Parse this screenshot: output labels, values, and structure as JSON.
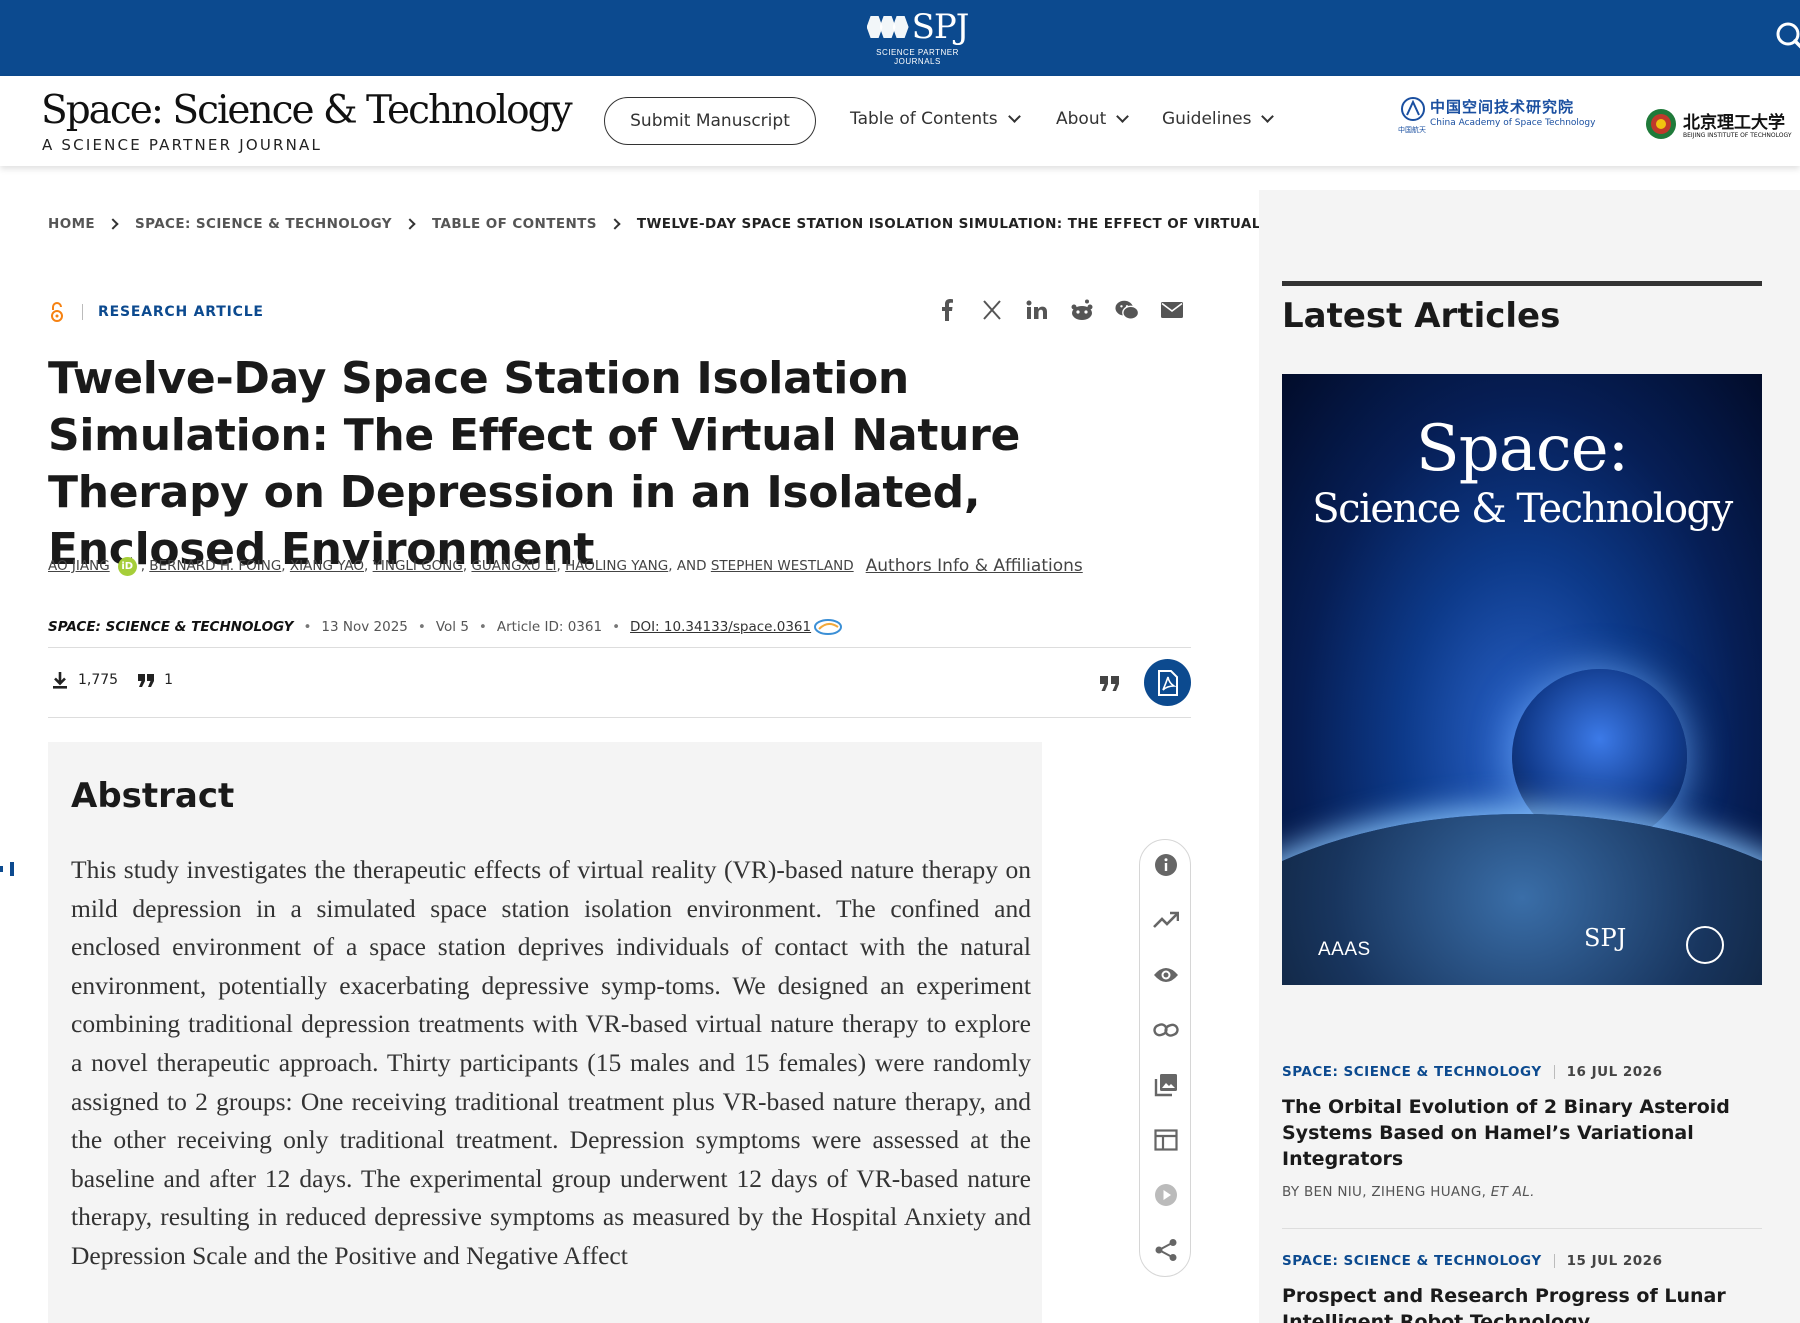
{
  "topbar": {
    "logo_text": "SPJ",
    "logo_sub": "SCIENCE PARTNER JOURNALS"
  },
  "header": {
    "journal_title": "Space: Science & Technology",
    "journal_subtitle": "A SCIENCE PARTNER JOURNAL",
    "submit_label": "Submit Manuscript",
    "nav": [
      "Table of Contents",
      "About",
      "Guidelines"
    ],
    "partner1_cn": "中国空间技术研究院",
    "partner1_en": "China Academy of Space Technology",
    "partner1_small": "中国航天",
    "partner2_cn": "北京理工大学",
    "partner2_en": "BEIJING INSTITUTE OF TECHNOLOGY"
  },
  "breadcrumb": [
    "HOME",
    "SPACE: SCIENCE & TECHNOLOGY",
    "TABLE OF CONTENTS",
    "TWELVE-DAY SPACE STATION ISOLATION SIMULATION: THE EFFECT OF VIRTUAL..."
  ],
  "article": {
    "type": "RESEARCH ARTICLE",
    "title": "Twelve-Day Space Station Isolation Simulation: The Effect of Virtual Nature Therapy on Depression in an Isolated, Enclosed Environment",
    "authors": [
      "AO JIANG",
      "BERNARD H. FOING",
      "XIANG YAO",
      "YINGLI GONG",
      "GUANGXU LI",
      "HAOLING YANG",
      "STEPHEN WESTLAND"
    ],
    "authors_and": ", AND",
    "orcid_label": "iD",
    "affiliations_link": "Authors Info & Affiliations",
    "journal": "SPACE: SCIENCE & TECHNOLOGY",
    "date": "13 Nov 2025",
    "volume": "Vol 5",
    "article_id": "Article ID: 0361",
    "doi": "DOI: 10.34133/space.0361",
    "downloads": "1,775",
    "citations": "1"
  },
  "abstract": {
    "heading": "Abstract",
    "text": "This study investigates the therapeutic effects of virtual reality (VR)-based nature therapy on mild depression in a simulated space station isolation environment. The confined and enclosed environment of a space station deprives individuals of contact with the natural environment, potentially exacerbating depressive symp-toms. We designed an experiment combining traditional depression treatments with VR-based virtual nature therapy to explore a novel therapeutic approach. Thirty participants (15 males and 15 females) were randomly assigned to 2 groups: One receiving traditional treatment plus VR-based nature therapy, and the other receiving only traditional treatment. Depression symptoms were assessed at the baseline and after 12 days. The experimental group underwent 12 days of VR-based nature therapy, resulting in reduced depressive symptoms as measured by the Hospital Anxiety and Depression Scale and the Positive and Negative Affect"
  },
  "sidebar": {
    "heading": "Latest Articles",
    "cover_line1": "Space:",
    "cover_line2": "Science & Technology",
    "cover_aaas": "AAAS",
    "cover_spj": "SPJ",
    "items": [
      {
        "journal": "SPACE: SCIENCE & TECHNOLOGY",
        "date": "16 JUL 2026",
        "title": "The Orbital Evolution of 2 Binary Asteroid Systems Based on Hamel’s Variational Integrators",
        "authors": "BY BEN NIU, ZIHENG HUANG,",
        "etal": "ET AL."
      },
      {
        "journal": "SPACE: SCIENCE & TECHNOLOGY",
        "date": "15 JUL 2026",
        "title": "Prospect and Research Progress of Lunar Intelligent Robot Technology"
      }
    ]
  },
  "colors": {
    "brand_blue": "#0c4a8f",
    "orcid_green": "#a6ce39",
    "oa_orange": "#f68212"
  }
}
